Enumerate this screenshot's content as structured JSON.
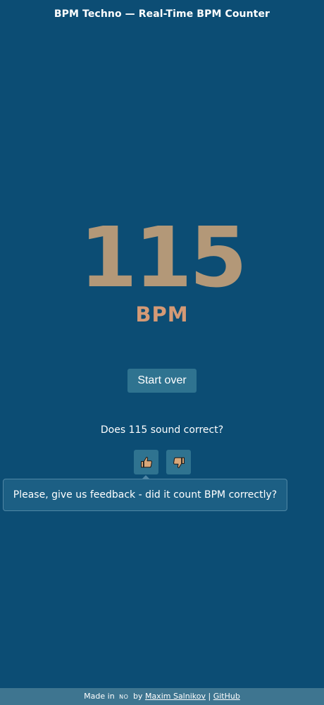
{
  "header": {
    "title": "BPM Techno — Real-Time BPM Counter"
  },
  "counter": {
    "value": "115",
    "unit": "BPM"
  },
  "controls": {
    "start_over_label": "Start over"
  },
  "feedback": {
    "question": "Does 115 sound correct?",
    "thumbs_up_icon": "thumbs-up-icon",
    "thumbs_down_icon": "thumbs-down-icon",
    "tooltip": "Please, give us feedback - did it count BPM correctly?"
  },
  "footer": {
    "made_in": "Made in",
    "flag": "NO",
    "by": "by",
    "author_link": "Maxim Salnikov",
    "separator": "|",
    "github_link": "GitHub"
  },
  "colors": {
    "background": "#0c4d74",
    "bpm_value": "#b39878",
    "bpm_unit": "#d49a76",
    "button": "#2f7390",
    "footer": "#3e7590",
    "icon_fill": "#d9a779"
  }
}
